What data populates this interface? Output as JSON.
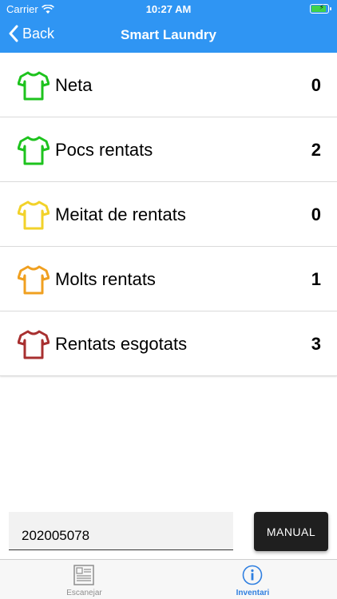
{
  "status_bar": {
    "carrier": "Carrier",
    "time": "10:27 AM"
  },
  "nav": {
    "back_label": "Back",
    "title": "Smart Laundry"
  },
  "colors": {
    "accent": "#2f95f3",
    "green": "#1ec31e",
    "yellow": "#f2d22a",
    "orange": "#f0a020",
    "red": "#a83030"
  },
  "inventory": [
    {
      "label": "Neta",
      "count": "0",
      "color": "#1ec31e"
    },
    {
      "label": "Pocs rentats",
      "count": "2",
      "color": "#1ec31e"
    },
    {
      "label": "Meitat de rentats",
      "count": "0",
      "color": "#f2d22a"
    },
    {
      "label": "Molts rentats",
      "count": "1",
      "color": "#f0a020"
    },
    {
      "label": "Rentats esgotats",
      "count": "3",
      "color": "#a83030"
    }
  ],
  "barcode": {
    "value": "202005078"
  },
  "manual_button": {
    "label": "MANUAL"
  },
  "tabs": [
    {
      "label": "Escanejar",
      "icon": "scan-icon"
    },
    {
      "label": "Inventari",
      "icon": "info-icon"
    }
  ]
}
